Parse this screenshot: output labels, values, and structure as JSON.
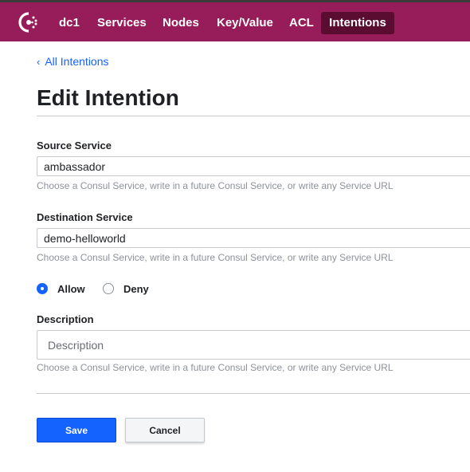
{
  "nav": {
    "items": [
      {
        "label": "dc1"
      },
      {
        "label": "Services"
      },
      {
        "label": "Nodes"
      },
      {
        "label": "Key/Value"
      },
      {
        "label": "ACL"
      },
      {
        "label": "Intentions"
      }
    ],
    "active": "Intentions"
  },
  "breadcrumb": {
    "label": "All Intentions"
  },
  "page": {
    "title": "Edit Intention"
  },
  "form": {
    "source": {
      "label": "Source Service",
      "value": "ambassador",
      "help": "Choose a Consul Service, write in a future Consul Service, or write any Service URL"
    },
    "destination": {
      "label": "Destination Service",
      "value": "demo-helloworld",
      "help": "Choose a Consul Service, write in a future Consul Service, or write any Service URL"
    },
    "action": {
      "options": [
        {
          "label": "Allow",
          "checked": true
        },
        {
          "label": "Deny",
          "checked": false
        }
      ]
    },
    "description": {
      "label": "Description",
      "placeholder": "Description",
      "help": "Choose a Consul Service, write in a future Consul Service, or write any Service URL"
    }
  },
  "buttons": {
    "save": "Save",
    "cancel": "Cancel"
  },
  "colors": {
    "header": "#961d59",
    "active_nav": "#5a0d31",
    "primary": "#1563ff"
  }
}
